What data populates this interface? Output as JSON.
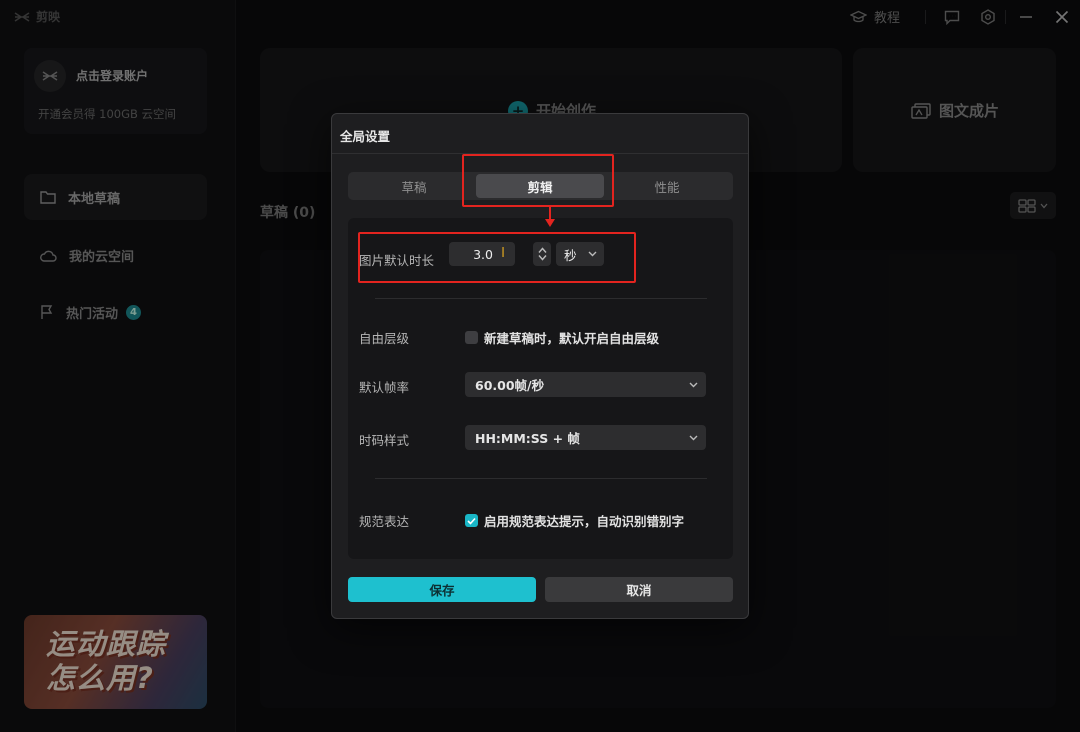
{
  "app": {
    "logo_text": "剪映",
    "account": {
      "login_label": "点击登录账户",
      "vip_label": "开通会员得 100GB 云空间"
    },
    "nav": [
      {
        "label": "本地草稿",
        "icon": "folder-icon"
      },
      {
        "label": "我的云空间",
        "icon": "cloud-icon"
      },
      {
        "label": "热门活动",
        "icon": "flag-icon",
        "badge": "4"
      }
    ],
    "promo": {
      "line1": "运动跟踪",
      "line2": "怎么用?"
    },
    "main": {
      "start_create_label": "开始创作",
      "graphic_video_label": "图文成片",
      "drafts_title": "草稿 (0)"
    },
    "topbar": {
      "tutorial_label": "教程"
    }
  },
  "modal": {
    "title": "全局设置",
    "tabs": [
      {
        "label": "草稿",
        "active": false
      },
      {
        "label": "剪辑",
        "active": true
      },
      {
        "label": "性能",
        "active": false
      }
    ],
    "image_duration": {
      "label": "图片默认时长",
      "value": "3.0",
      "unit": "秒"
    },
    "free_layer": {
      "label": "自由层级",
      "option_text": "新建草稿时，默认开启自由层级",
      "checked": false
    },
    "frame_rate": {
      "label": "默认帧率",
      "value": "60.00帧/秒"
    },
    "timecode": {
      "label": "时码样式",
      "value": "HH:MM:SS + 帧"
    },
    "standard_expr": {
      "label": "规范表达",
      "option_text": "启用规范表达提示，自动识别错别字",
      "checked": true
    },
    "save_label": "保存",
    "cancel_label": "取消"
  },
  "colors": {
    "accent": "#1ec0cf",
    "annotation": "#e3241f",
    "modal_bg": "#1e1e20"
  }
}
